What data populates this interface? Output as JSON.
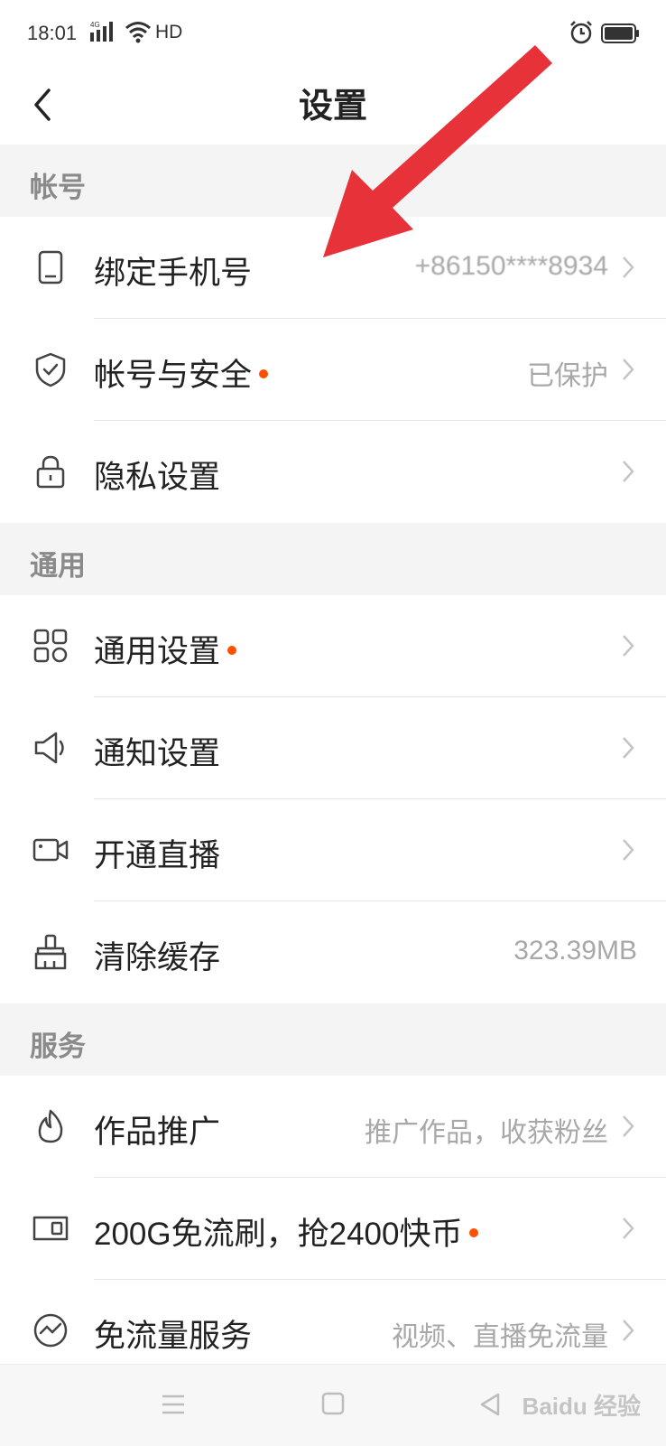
{
  "status_bar": {
    "time": "18:01",
    "network": "4G",
    "hd": "HD"
  },
  "nav": {
    "title": "设置"
  },
  "sections": {
    "account": "帐号",
    "general": "通用",
    "services": "服务"
  },
  "rows": {
    "bind_phone": {
      "label": "绑定手机号",
      "value": "+86150****8934"
    },
    "account_security": {
      "label": "帐号与安全",
      "value": "已保护"
    },
    "privacy": {
      "label": "隐私设置"
    },
    "general_settings": {
      "label": "通用设置"
    },
    "notifications": {
      "label": "通知设置"
    },
    "live": {
      "label": "开通直播"
    },
    "clear_cache": {
      "label": "清除缓存",
      "value": "323.39MB"
    },
    "promote": {
      "label": "作品推广",
      "value": "推广作品，收获粉丝"
    },
    "free_data": {
      "label": "200G免流刷，抢2400快币"
    },
    "data_service": {
      "label": "免流量服务",
      "value": "视频、直播免流量"
    }
  },
  "watermark": "Baidu 经验",
  "colors": {
    "accent_dot": "#ff5000",
    "annotation_arrow": "#e8323a",
    "section_bg": "#f4f4f4"
  }
}
